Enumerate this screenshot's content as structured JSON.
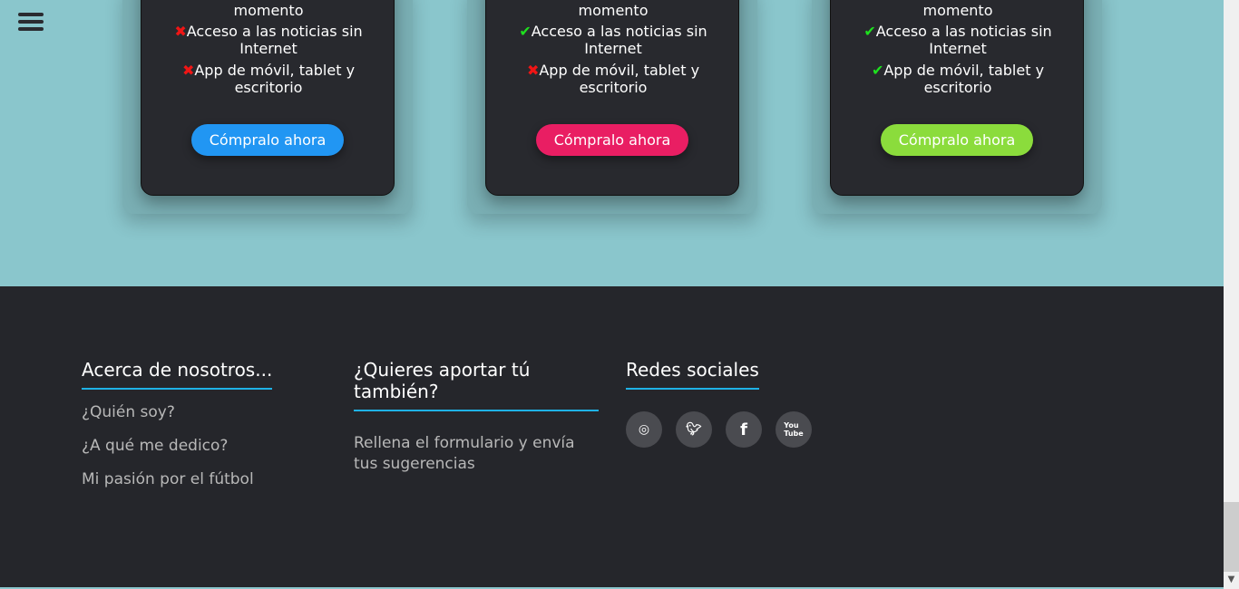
{
  "menu_icon": "hamburger-icon",
  "plans": [
    {
      "features": [
        {
          "ok": true,
          "text": "Notificaciones en todo momento"
        },
        {
          "ok": false,
          "text": "Acceso a las noticias sin Internet"
        },
        {
          "ok": false,
          "text": "App de móvil, tablet y escritorio"
        }
      ],
      "button": "Cómpralo ahora",
      "color": "#2196f3"
    },
    {
      "features": [
        {
          "ok": true,
          "text": "Notificaciones en todo momento"
        },
        {
          "ok": true,
          "text": "Acceso a las noticias sin Internet"
        },
        {
          "ok": false,
          "text": "App de móvil, tablet y escritorio"
        }
      ],
      "button": "Cómpralo ahora",
      "color": "#e91e63"
    },
    {
      "features": [
        {
          "ok": true,
          "text": "Notificaciones en todo momento"
        },
        {
          "ok": true,
          "text": "Acceso a las noticias sin Internet"
        },
        {
          "ok": true,
          "text": "App de móvil, tablet y escritorio"
        }
      ],
      "button": "Cómpralo ahora",
      "color": "#8bdc3c"
    }
  ],
  "footer": {
    "about": {
      "title": "Acerca de nosotros...",
      "links": [
        "¿Quién soy?",
        "¿A qué me dedico?",
        "Mi pasión por el fútbol"
      ]
    },
    "contribute": {
      "title": "¿Quieres aportar tú también?",
      "text": "Rellena el formulario y envía tus sugerencias"
    },
    "social": {
      "title": "Redes sociales",
      "icons": [
        "instagram-icon",
        "twitter-icon",
        "facebook-icon",
        "youtube-icon"
      ]
    }
  }
}
